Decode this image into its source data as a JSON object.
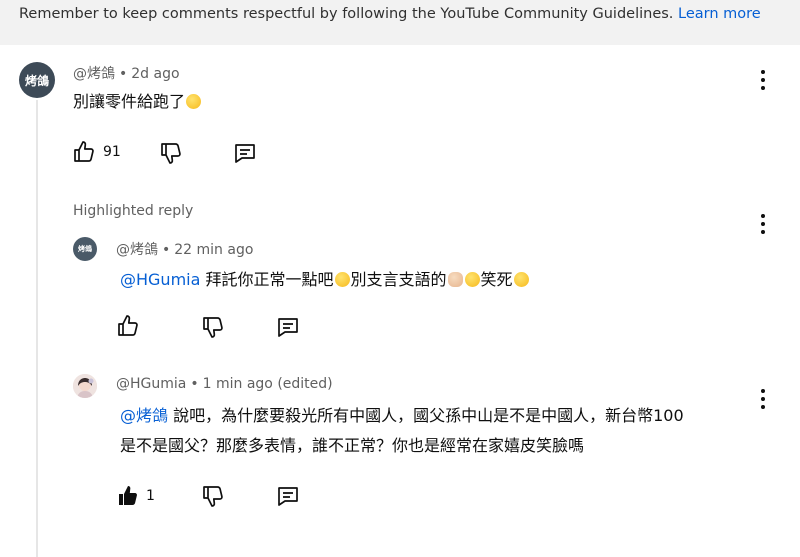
{
  "banner": {
    "text": "Remember to keep comments respectful by following the YouTube Community Guidelines.",
    "link": "Learn more"
  },
  "comment": {
    "avatar_text": "烤鴿",
    "author": "@烤鴿",
    "time": "2d ago",
    "text": "別讓零件給跑了",
    "emoji": "sweat-smile-emoji",
    "like_count": "91"
  },
  "highlighted_label": "Highlighted reply",
  "replies": [
    {
      "avatar_text": "烤鴿",
      "author": "@烤鴿",
      "time": "22 min ago",
      "mention": "@HGumia",
      "text_parts": [
        "拜託你正常一點吧",
        "別支言支語的",
        "笑死"
      ]
    },
    {
      "author": "@HGumia",
      "time": "1 min ago (edited)",
      "mention": "@烤鴿",
      "line1": "說吧，為什麼要殺光所有中國人，國父孫中山是不是中國人，新台幣100",
      "line2": "是不是國父？那麼多表情，誰不正常？你也是經常在家嬉皮笑臉嗎",
      "like_count": "1"
    }
  ],
  "icons": {
    "like": "thumbs-up-icon",
    "dislike": "thumbs-down-icon",
    "reply": "reply-icon",
    "more": "more-vert-icon"
  },
  "colors": {
    "link": "#065fd4",
    "banner_bg": "#f2f2f2",
    "meta": "#606060"
  }
}
